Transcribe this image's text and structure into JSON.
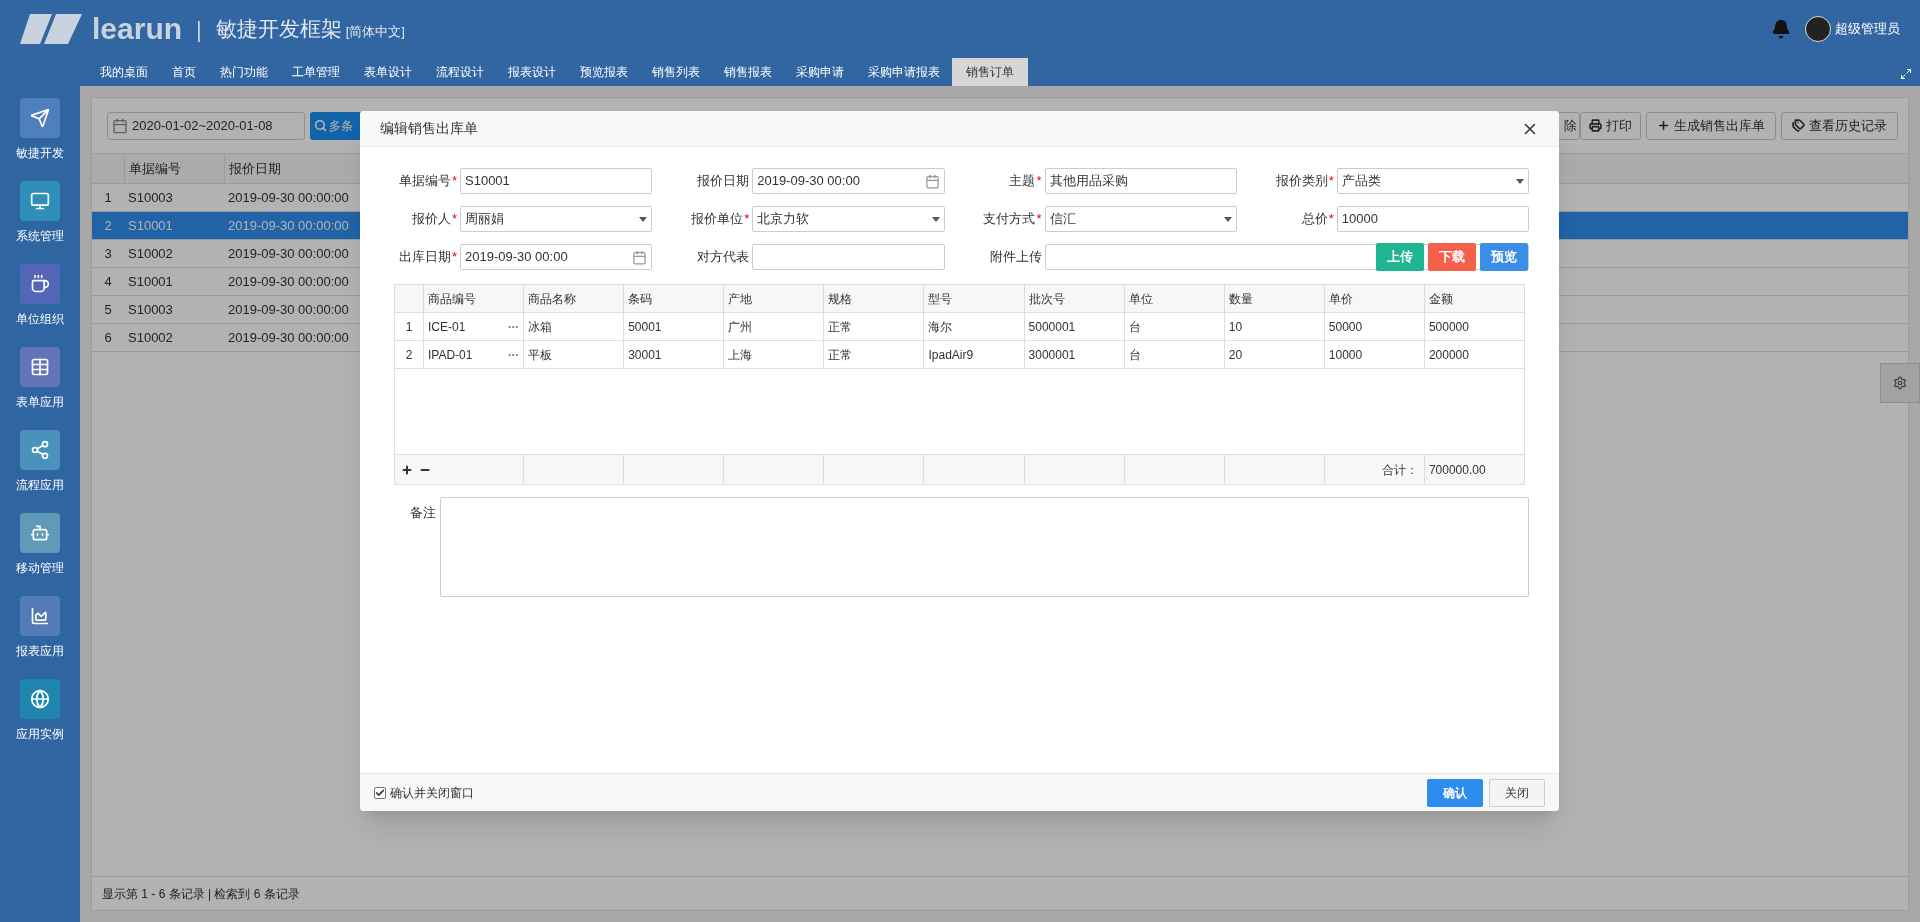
{
  "header": {
    "logo_text": "learun",
    "separator": "|",
    "title": "敏捷开发框架",
    "language": "[简体中文]",
    "user": "超级管理员"
  },
  "tabs": [
    {
      "label": "我的桌面",
      "selected": false
    },
    {
      "label": "首页",
      "selected": false
    },
    {
      "label": "热门功能",
      "selected": false
    },
    {
      "label": "工单管理",
      "selected": false
    },
    {
      "label": "表单设计",
      "selected": false
    },
    {
      "label": "流程设计",
      "selected": false
    },
    {
      "label": "报表设计",
      "selected": false
    },
    {
      "label": "预览报表",
      "selected": false
    },
    {
      "label": "销售列表",
      "selected": false
    },
    {
      "label": "销售报表",
      "selected": false
    },
    {
      "label": "采购申请",
      "selected": false
    },
    {
      "label": "采购申请报表",
      "selected": false
    },
    {
      "label": "销售订单",
      "selected": true
    }
  ],
  "sidebar": {
    "items": [
      {
        "label": "敏捷开发",
        "color": "#4f7fbd"
      },
      {
        "label": "系统管理",
        "color": "#2f8fb8"
      },
      {
        "label": "单位组织",
        "color": "#5366b8"
      },
      {
        "label": "表单应用",
        "color": "#6474b8"
      },
      {
        "label": "流程应用",
        "color": "#4a92bc"
      },
      {
        "label": "移动管理",
        "color": "#5f9ab8"
      },
      {
        "label": "报表应用",
        "color": "#527cb5"
      },
      {
        "label": "应用实例",
        "color": "#1f86b0"
      }
    ]
  },
  "list_page": {
    "date_range": "2020-01-02~2020-01-08",
    "search_button": "多条",
    "toolbar_buttons": [
      {
        "label": "除"
      },
      {
        "label": "打印"
      },
      {
        "label": "生成销售出库单"
      },
      {
        "label": "查看历史记录"
      }
    ],
    "table": {
      "columns": [
        "单据编号",
        "报价日期"
      ],
      "rows": [
        {
          "index": "1",
          "code": "S10003",
          "date": "2019-09-30 00:00:00",
          "selected": false
        },
        {
          "index": "2",
          "code": "S10001",
          "date": "2019-09-30 00:00:00",
          "selected": true
        },
        {
          "index": "3",
          "code": "S10002",
          "date": "2019-09-30 00:00:00",
          "selected": false
        },
        {
          "index": "4",
          "code": "S10001",
          "date": "2019-09-30 00:00:00",
          "selected": false
        },
        {
          "index": "5",
          "code": "S10003",
          "date": "2019-09-30 00:00:00",
          "selected": false
        },
        {
          "index": "6",
          "code": "S10002",
          "date": "2019-09-30 00:00:00",
          "selected": false
        }
      ]
    },
    "footer": "显示第 1 - 6 条记录 | 检索到 6 条记录"
  },
  "dialog": {
    "title": "编辑销售出库单",
    "required_mark": "*",
    "fields": [
      {
        "label": "单据编号",
        "required": true,
        "kind": "text",
        "value": "S10001"
      },
      {
        "label": "报价日期",
        "required": false,
        "kind": "date",
        "value": "2019-09-30 00:00"
      },
      {
        "label": "主题",
        "required": true,
        "kind": "text",
        "value": "其他用品采购"
      },
      {
        "label": "报价类别",
        "required": true,
        "kind": "select",
        "value": "产品类"
      },
      {
        "label": "报价人",
        "required": true,
        "kind": "select",
        "value": "周丽娟"
      },
      {
        "label": "报价单位",
        "required": true,
        "kind": "select",
        "value": "北京力软"
      },
      {
        "label": "支付方式",
        "required": true,
        "kind": "select",
        "value": "信汇"
      },
      {
        "label": "总价",
        "required": true,
        "kind": "text",
        "value": "10000"
      },
      {
        "label": "出库日期",
        "required": true,
        "kind": "date",
        "value": "2019-09-30 00:00"
      },
      {
        "label": "对方代表",
        "required": false,
        "kind": "text"
      },
      {
        "label": "附件上传",
        "required": false,
        "kind": "upload",
        "buttons": [
          {
            "label": "上传",
            "color": "#1fb592"
          },
          {
            "label": "下载",
            "color": "#f5604a"
          },
          {
            "label": "预览",
            "color": "#3a8ee6"
          }
        ]
      }
    ],
    "items_table": {
      "columns": [
        "商品编号",
        "商品名称",
        "条码",
        "产地",
        "规格",
        "型号",
        "批次号",
        "单位",
        "数量",
        "单价",
        "金额"
      ],
      "rows": [
        {
          "index": "1",
          "cells": [
            "ICE-01",
            "冰箱",
            "50001",
            "广州",
            "正常",
            "海尔",
            "5000001",
            "台",
            "10",
            "50000",
            "500000"
          ]
        },
        {
          "index": "2",
          "cells": [
            "IPAD-01",
            "平板",
            "30001",
            "上海",
            "正常",
            "IpadAir9",
            "3000001",
            "台",
            "20",
            "10000",
            "200000"
          ]
        }
      ],
      "total_label": "合计：",
      "total": "700000.00"
    },
    "remark_label": "备注",
    "close_after_confirm": {
      "label": "确认并关闭窗口",
      "checked": true
    },
    "confirm": "确认",
    "close": "关闭"
  }
}
